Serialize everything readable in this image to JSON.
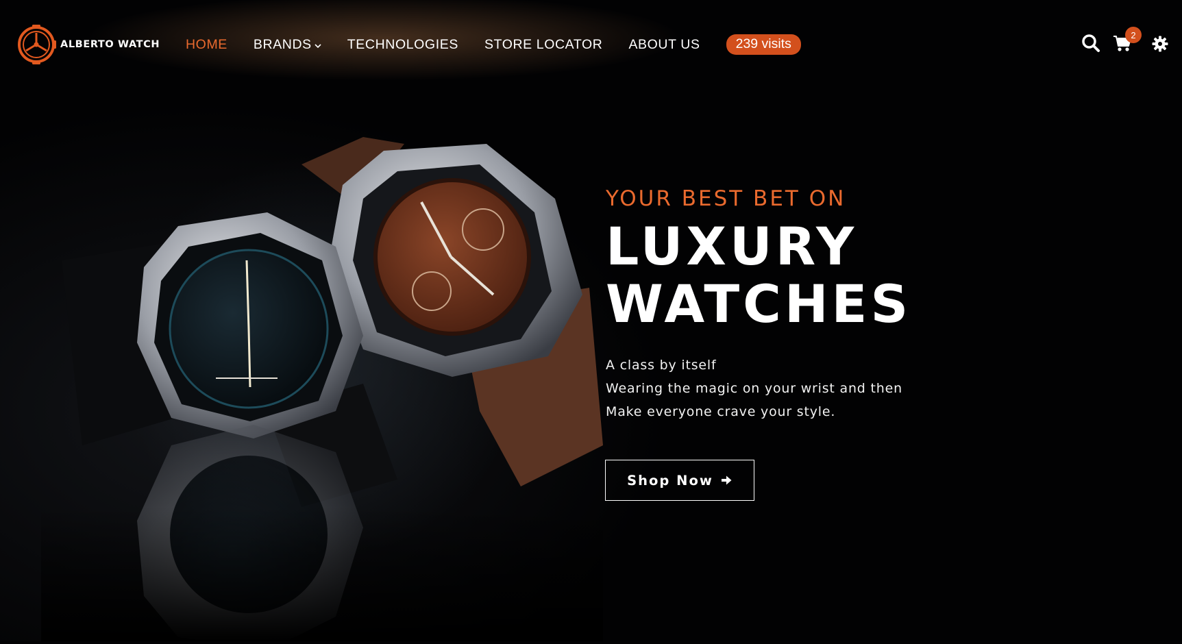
{
  "brand": {
    "name": "ALBERTO WATCH",
    "accent_color": "#ea6a2e",
    "badge_color": "#d3501d"
  },
  "nav": {
    "items": [
      {
        "label": "HOME",
        "active": true
      },
      {
        "label": "BRANDS",
        "has_dropdown": true
      },
      {
        "label": "TECHNOLOGIES"
      },
      {
        "label": "STORE LOCATOR"
      },
      {
        "label": "ABOUT US"
      }
    ],
    "visits_badge": "239 visits"
  },
  "header_icons": {
    "search": "search-icon",
    "cart": "cart-icon",
    "cart_count": "2",
    "settings": "gear-icon"
  },
  "hero": {
    "eyebrow": "YOUR BEST BET ON",
    "headline_line1": "LUXURY",
    "headline_line2": "WATCHES",
    "tagline": [
      "A class by itself",
      "Wearing the magic on your wrist and then",
      "Make everyone crave your style."
    ],
    "cta_label": "Shop Now",
    "cta_icon": "arrow-right-icon"
  }
}
